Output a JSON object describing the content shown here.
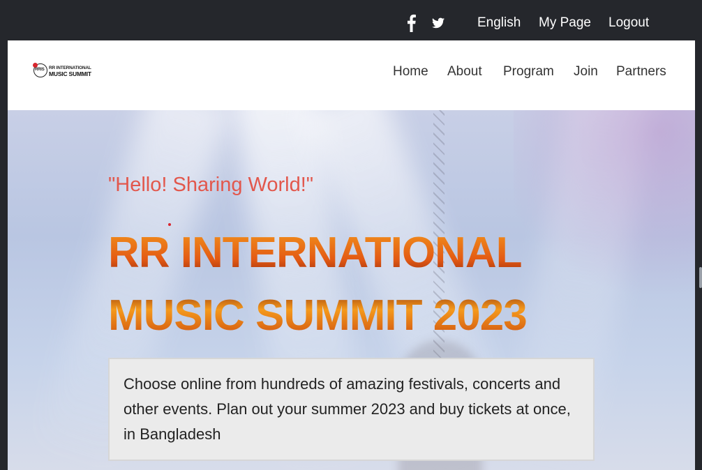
{
  "topbar": {
    "social": [
      {
        "icon": "facebook-icon"
      },
      {
        "icon": "twitter-icon"
      }
    ],
    "language": "English",
    "my_page": "My Page",
    "logout": "Logout"
  },
  "header": {
    "logo": {
      "mark_text": "RRIS",
      "line1": "RR INTERNATIONAL",
      "line2": "MUSIC SUMMIT"
    },
    "nav": [
      "Home",
      "About",
      "Program",
      "Join",
      "Partners"
    ]
  },
  "hero": {
    "tagline": "\"Hello! Sharing World!\"",
    "title_line1": "RR INTERNATIONAL",
    "title_line2": "MUSIC SUMMIT 2023",
    "description": "Choose online from hundreds of amazing festivals, concerts and other events. Plan out your summer 2023 and buy tickets at once, in Bangladesh"
  },
  "colors": {
    "topbar_bg": "#25272c",
    "tagline": "#e2574c",
    "title_fire": "#e35a14",
    "description_box": "#ebebeb"
  }
}
